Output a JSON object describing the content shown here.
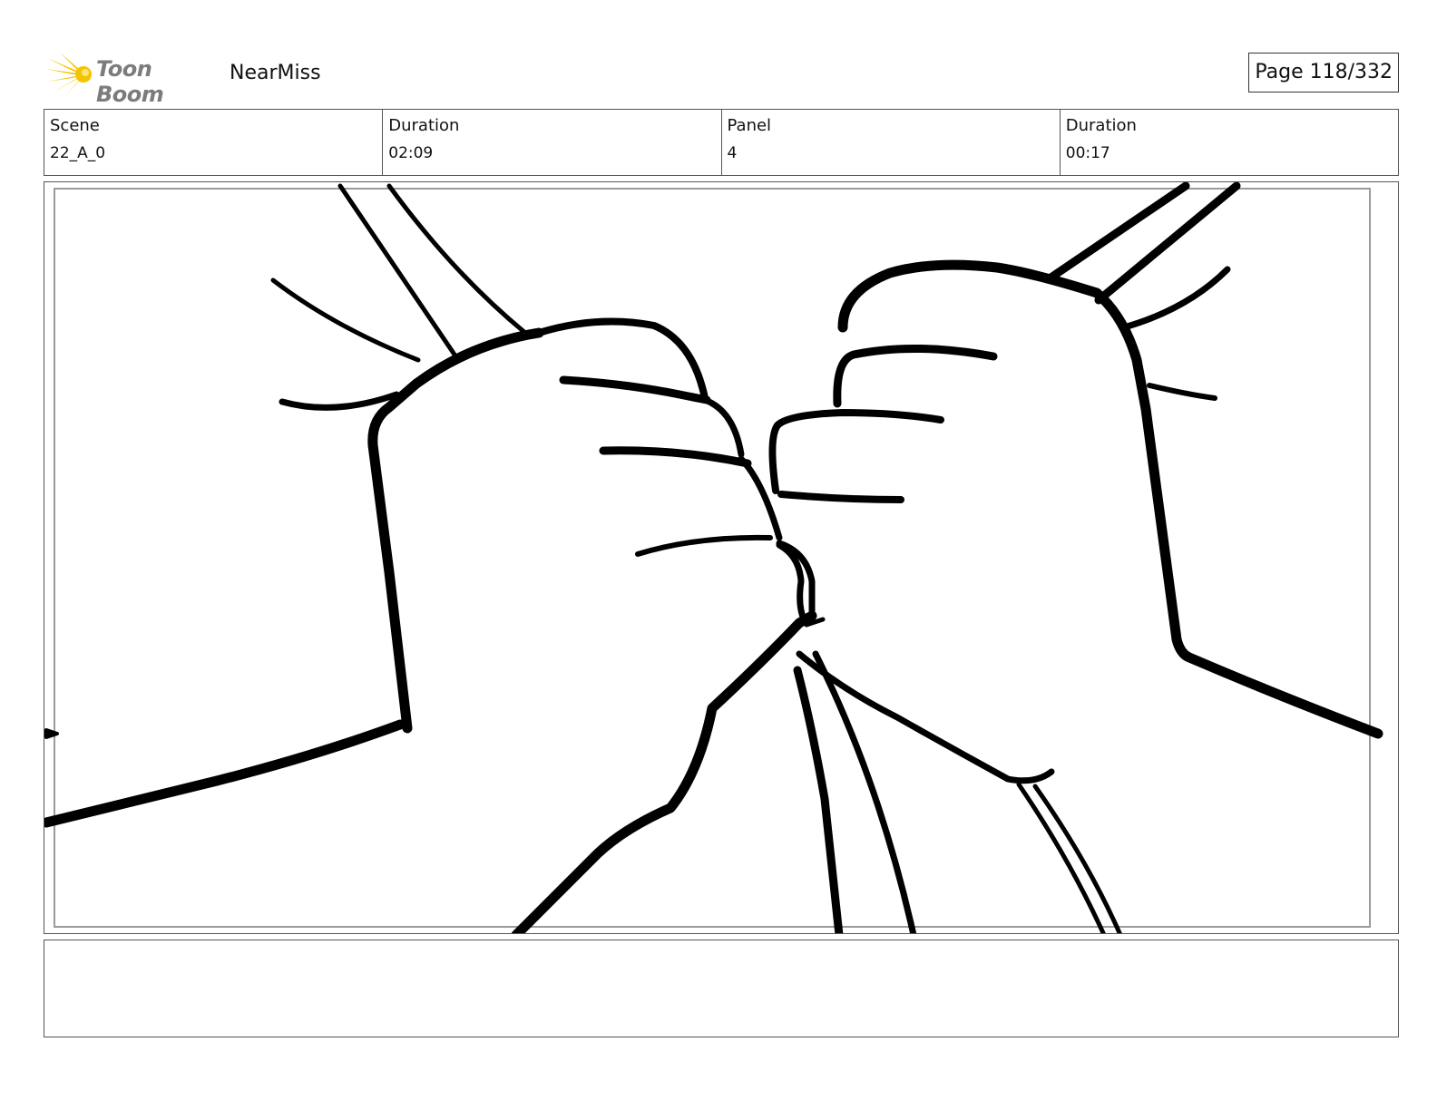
{
  "header": {
    "logo_text": "Toon Boom",
    "project_title": "NearMiss",
    "page_label": "Page 118/332"
  },
  "info": {
    "scene_label": "Scene",
    "scene_value": "22_A_0",
    "scene_duration_label": "Duration",
    "scene_duration_value": "02:09",
    "panel_label": "Panel",
    "panel_value": "4",
    "panel_duration_label": "Duration",
    "panel_duration_value": "00:17"
  },
  "drawing": {
    "icon": "fist-bump-sketch",
    "stroke_color": "#000000"
  },
  "colors": {
    "logo_burst": "#f5c400",
    "logo_text": "#7c7c7c"
  }
}
